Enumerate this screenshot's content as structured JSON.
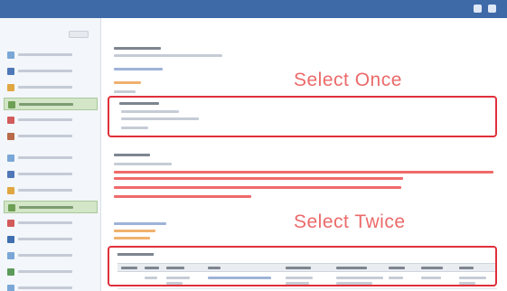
{
  "window": {
    "title": "",
    "app_label": ""
  },
  "overlays": {
    "select_once": "Select Once",
    "select_twice": "Select Twice"
  },
  "colors": {
    "titlebar": "#3e6aa8",
    "highlight_box": "#e0303a",
    "overlay_text": "#ec6a6a",
    "active_sidebar_item": "#d3e6c7"
  },
  "sidebar": {
    "active_index": 4,
    "icons": [
      "page-icon",
      "user-icon",
      "folder-icon",
      "list-icon",
      "tag-icon",
      "shield-icon",
      "page-icon",
      "user-icon",
      "folder-icon",
      "list-icon",
      "tag-icon",
      "shield-icon",
      "page-icon",
      "user-icon",
      "folder-icon"
    ]
  }
}
